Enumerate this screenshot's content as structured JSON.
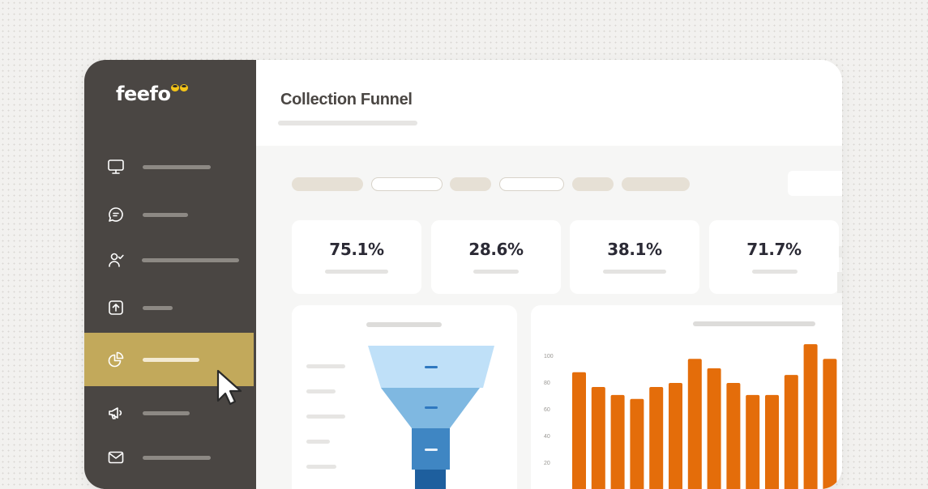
{
  "app": {
    "brand": "feefo",
    "title": "Collection Funnel",
    "accent": "#c2a95b",
    "sidebar_bg": "#4a4643"
  },
  "sidebar": {
    "items": [
      {
        "icon": "monitor-icon",
        "active": false
      },
      {
        "icon": "chat-bubble-icon",
        "active": false
      },
      {
        "icon": "user-check-icon",
        "active": false
      },
      {
        "icon": "upload-icon",
        "active": false
      },
      {
        "icon": "pie-chart-icon",
        "active": true
      },
      {
        "icon": "megaphone-icon",
        "active": false
      },
      {
        "icon": "mail-icon",
        "active": false
      }
    ]
  },
  "kpis": [
    {
      "value": "75.1%"
    },
    {
      "value": "28.6%"
    },
    {
      "value": "38.1%"
    },
    {
      "value": "71.7%"
    }
  ],
  "funnel": {
    "colors": [
      "#bfe0f8",
      "#7fb8e1",
      "#3f86c3",
      "#1e5f9e"
    ]
  },
  "chart_data": {
    "type": "bar",
    "color": "#e46d0a",
    "y_ticks": [
      "100",
      "80",
      "60",
      "40",
      "20"
    ],
    "ylim": [
      0,
      110
    ],
    "values": [
      88,
      77,
      71,
      68,
      77,
      80,
      98,
      91,
      80,
      71,
      71,
      86,
      109,
      98
    ],
    "grid": false,
    "legend": "none"
  }
}
